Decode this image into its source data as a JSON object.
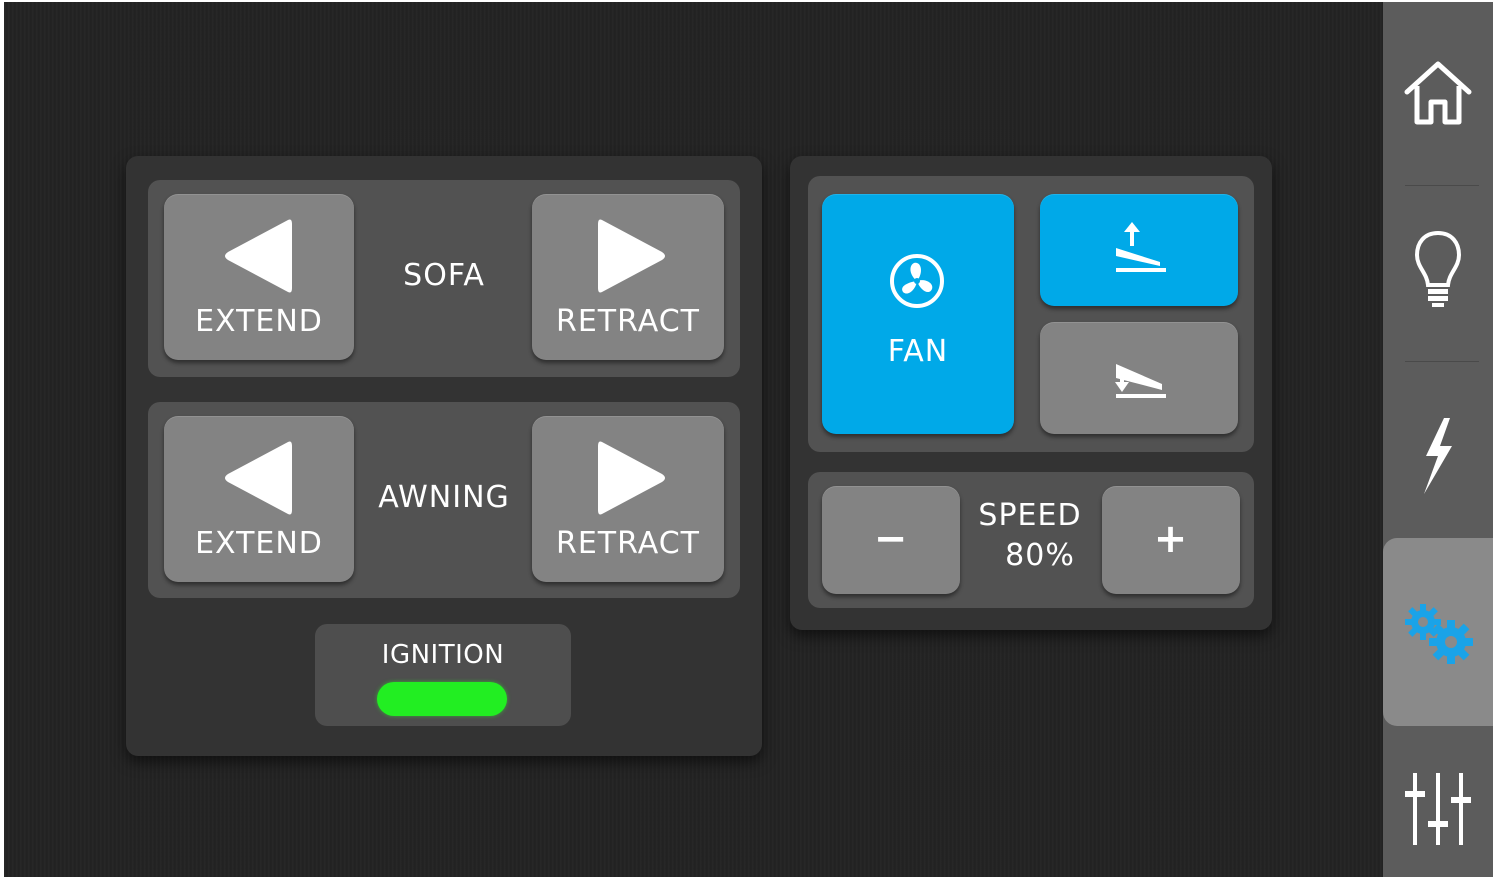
{
  "colors": {
    "background": "#232323",
    "panel": "#333333",
    "group": "#525252",
    "button": "#838383",
    "active_blue": "#00a9e8",
    "indicator_green": "#22ee22",
    "sidebar": "#5c5c5c",
    "sidebar_active": "#8a8a8a",
    "active_icon": "#1aa3e8"
  },
  "slide_panel": {
    "sofa": {
      "label": "SOFA",
      "extend_label": "EXTEND",
      "retract_label": "RETRACT"
    },
    "awning": {
      "label": "AWNING",
      "extend_label": "EXTEND",
      "retract_label": "RETRACT"
    },
    "ignition": {
      "label": "IGNITION",
      "status": "on"
    }
  },
  "fan_panel": {
    "fan_label": "FAN",
    "fan_active": true,
    "lid_open_active": true,
    "lid_close_active": false,
    "speed": {
      "label": "SPEED",
      "value": "80%",
      "minus_label": "−",
      "plus_label": "+"
    }
  },
  "sidebar": {
    "items": [
      {
        "icon": "home-icon"
      },
      {
        "icon": "lightbulb-icon"
      },
      {
        "icon": "lightning-icon"
      },
      {
        "icon": "gears-icon",
        "active": true
      },
      {
        "icon": "sliders-icon"
      }
    ]
  }
}
